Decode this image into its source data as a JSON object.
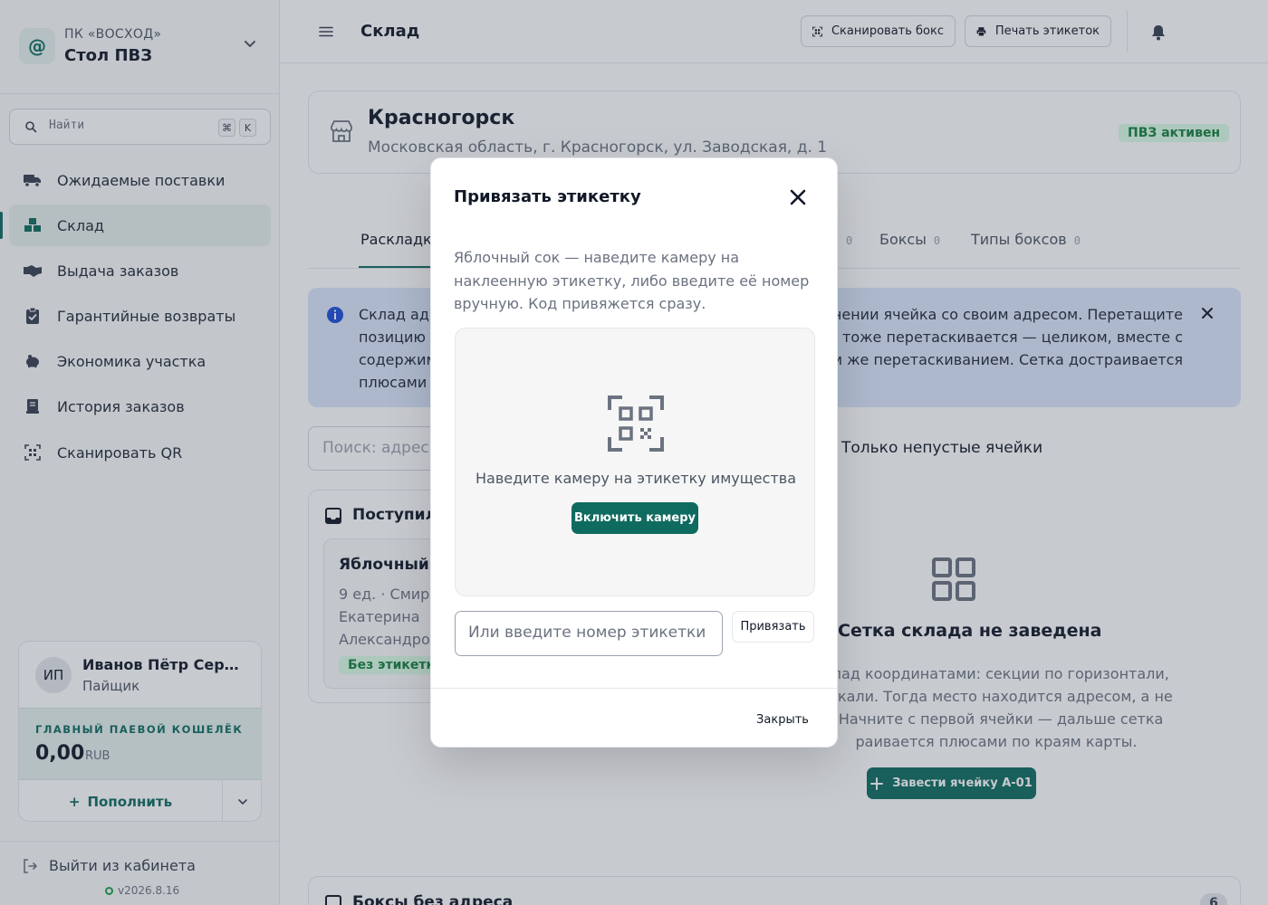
{
  "sidebar": {
    "org": {
      "logo": "@",
      "sub": "ПК «ВОСХОД»",
      "name": "Стол ПВЗ"
    },
    "search": {
      "placeholder": "Найти",
      "kbd1": "⌘",
      "kbd2": "K"
    },
    "nav": [
      {
        "label": "Ожидаемые поставки",
        "icon": "truck-icon"
      },
      {
        "label": "Склад",
        "icon": "boxes-icon",
        "active": true
      },
      {
        "label": "Выдача заказов",
        "icon": "handshake-icon"
      },
      {
        "label": "Гарантийные возвраты",
        "icon": "clipboard-check-icon"
      },
      {
        "label": "Экономика участка",
        "icon": "piggy-bank-icon"
      },
      {
        "label": "История заказов",
        "icon": "receipt-icon"
      },
      {
        "label": "Сканировать QR",
        "icon": "qr-scan-icon"
      }
    ],
    "user": {
      "initials": "ИП",
      "name": "Иванов Пётр Серге...",
      "role": "Пайщик",
      "wallet_title": "ГЛАВНЫЙ ПАЕВОЙ КОШЕЛЁК",
      "wallet_amount": "0,00",
      "wallet_currency": "RUB",
      "topup_label": "Пополнить",
      "topup_plus": "+"
    },
    "logout_label": "Выйти из кабинета",
    "version": "v2026.8.16"
  },
  "topbar": {
    "title": "Склад",
    "scan_box_label": "Сканировать бокс",
    "print_labels_label": "Печать этикеток"
  },
  "main": {
    "city": "Красногорск",
    "address": "Московская область, г. Красногорск, ул. Заводская, д. 1",
    "status_badge": "ПВЗ активен",
    "tabs": [
      {
        "label": "Раскладка"
      },
      {
        "label": "",
        "count": "0"
      },
      {
        "label": "Боксы",
        "count": "0"
      },
      {
        "label": "Типы боксов",
        "count": "0"
      }
    ],
    "info_lines": [
      "Склад адр",
      "чении ячейка со своим адресом. Перетащите",
      "позицию в",
      "с тоже перетаскивается — целиком, вместе с",
      "содержим",
      "ем же перетаскиванием. Сетка достраивается",
      "плюсами п"
    ],
    "grid_search_placeholder": "Поиск: адрес,",
    "toggle_label": "Только непустые ячейки",
    "inbox": {
      "title": "Поступил",
      "item_name": "Яблочный с",
      "item_meta_1": "9 ед. · Смирн",
      "item_meta_2": "Екатерина",
      "item_meta_3": "Александров",
      "item_badge": "Без этикетк"
    },
    "empty": {
      "title": "Сетка склада не заведена",
      "text_1": "клад координатами: секции по горизонтали,",
      "text_2": "тикали. Тогда место находится адресом, а не",
      "text_3": ". Начните с первой ячейки — дальше сетка",
      "text_4": "раивается плюсами по краям карты.",
      "button": "Завести ячейку А-01"
    },
    "boxes": {
      "title": "Боксы без адреса",
      "count": "6"
    }
  },
  "modal": {
    "title": "Привязать этикетку",
    "description": "Яблочный сок — наведите камеру на наклеенную этикетку, либо введите её номер вручную. Код привяжется сразу.",
    "scan_hint": "Наведите камеру на этикетку имущества",
    "camera_button": "Включить камеру",
    "input_placeholder": "Или введите номер этикетки",
    "bind_button": "Привязать",
    "close_button": "Закрыть"
  },
  "colors": {
    "accent": "#0f6b5f",
    "info_bg": "#dbe7fb",
    "success": "#15803d"
  }
}
